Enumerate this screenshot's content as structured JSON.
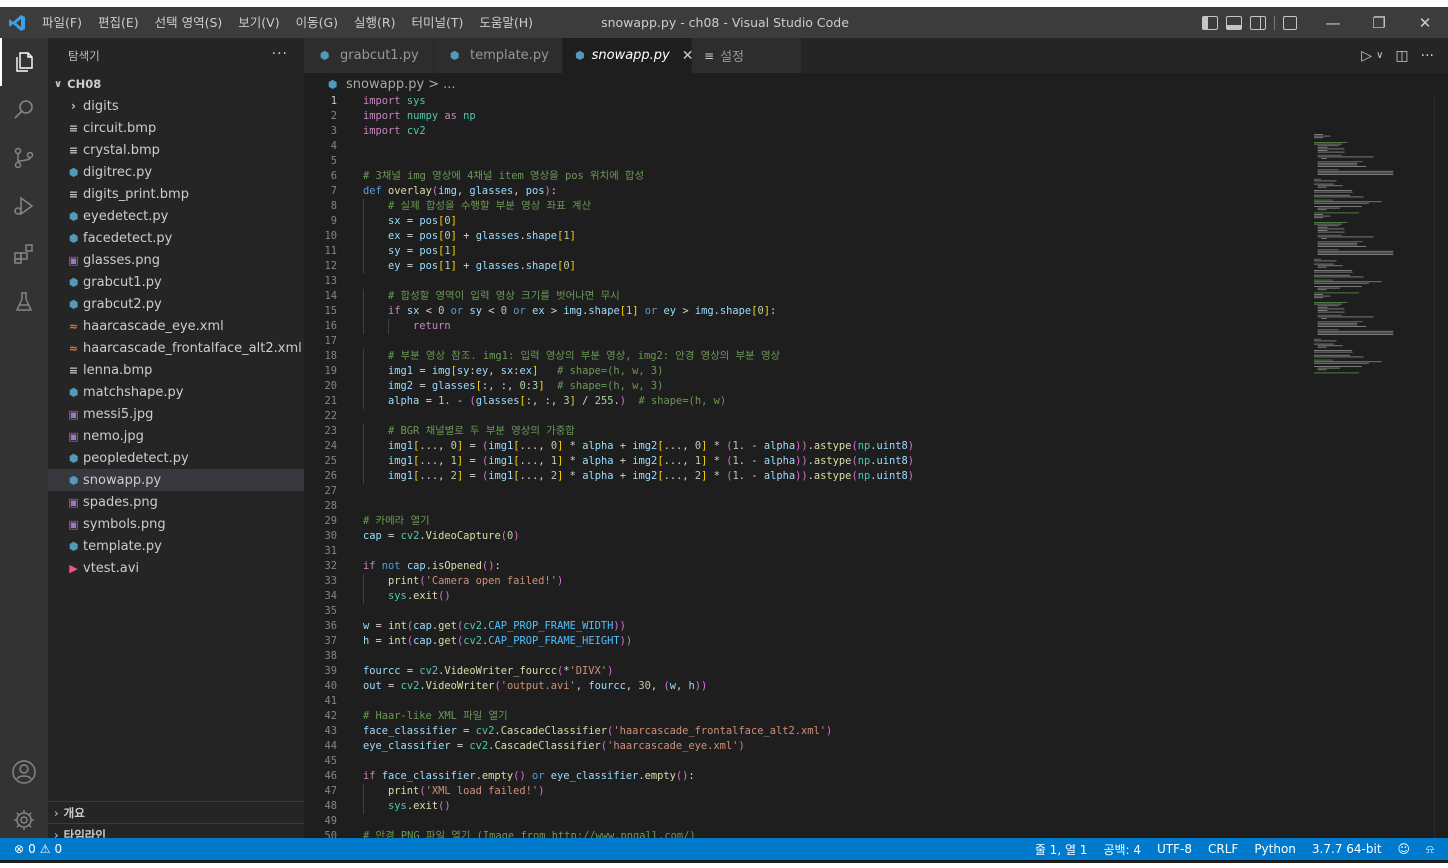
{
  "titlebar": {
    "menu": [
      "파일(F)",
      "편집(E)",
      "선택 영역(S)",
      "보기(V)",
      "이동(G)",
      "실행(R)",
      "터미널(T)",
      "도움말(H)"
    ],
    "title": "snowapp.py - ch08 - Visual Studio Code"
  },
  "colors": {
    "accent": "#007acc",
    "background": "#1e1e1e",
    "sidebar": "#252526",
    "activitybar": "#333333",
    "titlebar": "#3c3c3c"
  },
  "activitybar": {
    "top": [
      "explorer-icon",
      "search-icon",
      "source-control-icon",
      "run-debug-icon",
      "extensions-icon",
      "testing-icon"
    ],
    "bottom": [
      "account-icon",
      "settings-gear-icon"
    ]
  },
  "sidebar": {
    "title": "탐색기",
    "folder": "CH08",
    "items": [
      {
        "label": "digits",
        "type": "dir"
      },
      {
        "label": "circuit.bmp",
        "type": "txt"
      },
      {
        "label": "crystal.bmp",
        "type": "txt"
      },
      {
        "label": "digitrec.py",
        "type": "py"
      },
      {
        "label": "digits_print.bmp",
        "type": "txt"
      },
      {
        "label": "eyedetect.py",
        "type": "py"
      },
      {
        "label": "facedetect.py",
        "type": "py"
      },
      {
        "label": "glasses.png",
        "type": "img"
      },
      {
        "label": "grabcut1.py",
        "type": "py"
      },
      {
        "label": "grabcut2.py",
        "type": "py"
      },
      {
        "label": "haarcascade_eye.xml",
        "type": "xml"
      },
      {
        "label": "haarcascade_frontalface_alt2.xml",
        "type": "xml"
      },
      {
        "label": "lenna.bmp",
        "type": "txt"
      },
      {
        "label": "matchshape.py",
        "type": "py"
      },
      {
        "label": "messi5.jpg",
        "type": "img"
      },
      {
        "label": "nemo.jpg",
        "type": "img"
      },
      {
        "label": "peopledetect.py",
        "type": "py"
      },
      {
        "label": "snowapp.py",
        "type": "py"
      },
      {
        "label": "spades.png",
        "type": "img"
      },
      {
        "label": "symbols.png",
        "type": "img"
      },
      {
        "label": "template.py",
        "type": "py"
      },
      {
        "label": "vtest.avi",
        "type": "avi"
      }
    ],
    "selected": "snowapp.py",
    "outline": "개요",
    "timeline": "타임라인"
  },
  "tabs": [
    {
      "label": "grabcut1.py",
      "icon": "python-icon"
    },
    {
      "label": "template.py",
      "icon": "python-icon"
    },
    {
      "label": "snowapp.py",
      "icon": "python-icon",
      "active": true
    },
    {
      "label": "설정",
      "icon": "settings-list-icon"
    }
  ],
  "breadcrumb": {
    "file": "snowapp.py",
    "sep": ">",
    "rest": "..."
  },
  "code": {
    "current_line": 1,
    "lines": [
      "import sys",
      "import numpy as np",
      "import cv2",
      "",
      "",
      "# 3채널 img 영상에 4채널 item 영상을 pos 위치에 합성",
      "def overlay(img, glasses, pos):",
      "    # 실제 합성을 수행할 부분 영상 좌표 계산",
      "    sx = pos[0]",
      "    ex = pos[0] + glasses.shape[1]",
      "    sy = pos[1]",
      "    ey = pos[1] + glasses.shape[0]",
      "",
      "    # 합성할 영역이 입력 영상 크기를 벗어나면 무시",
      "    if sx < 0 or sy < 0 or ex > img.shape[1] or ey > img.shape[0]:",
      "        return",
      "",
      "    # 부분 영상 참조. img1: 입력 영상의 부분 영상, img2: 안경 영상의 부분 영상",
      "    img1 = img[sy:ey, sx:ex]   # shape=(h, w, 3)",
      "    img2 = glasses[:, :, 0:3]  # shape=(h, w, 3)",
      "    alpha = 1. - (glasses[:, :, 3] / 255.)  # shape=(h, w)",
      "",
      "    # BGR 채널별로 두 부분 영상의 가중합",
      "    img1[..., 0] = (img1[..., 0] * alpha + img2[..., 0] * (1. - alpha)).astype(np.uint8)",
      "    img1[..., 1] = (img1[..., 1] * alpha + img2[..., 1] * (1. - alpha)).astype(np.uint8)",
      "    img1[..., 2] = (img1[..., 2] * alpha + img2[..., 2] * (1. - alpha)).astype(np.uint8)",
      "",
      "",
      "# 카메라 열기",
      "cap = cv2.VideoCapture(0)",
      "",
      "if not cap.isOpened():",
      "    print('Camera open failed!')",
      "    sys.exit()",
      "",
      "w = int(cap.get(cv2.CAP_PROP_FRAME_WIDTH))",
      "h = int(cap.get(cv2.CAP_PROP_FRAME_HEIGHT))",
      "",
      "fourcc = cv2.VideoWriter_fourcc(*'DIVX')",
      "out = cv2.VideoWriter('output.avi', fourcc, 30, (w, h))",
      "",
      "# Haar-like XML 파일 열기",
      "face_classifier = cv2.CascadeClassifier('haarcascade_frontalface_alt2.xml')",
      "eye_classifier = cv2.CascadeClassifier('haarcascade_eye.xml')",
      "",
      "if face_classifier.empty() or eye_classifier.empty():",
      "    print('XML load failed!')",
      "    sys.exit()",
      "",
      "# 안경 PNG 파일 열기 (Image from http://www.pngall.com/)"
    ]
  },
  "statusbar": {
    "errors": "0",
    "warnings": "0",
    "position": "줄 1, 열 1",
    "spaces": "공백: 4",
    "encoding": "UTF-8",
    "eol": "CRLF",
    "language": "Python",
    "interpreter": "3.7.7 64-bit"
  }
}
